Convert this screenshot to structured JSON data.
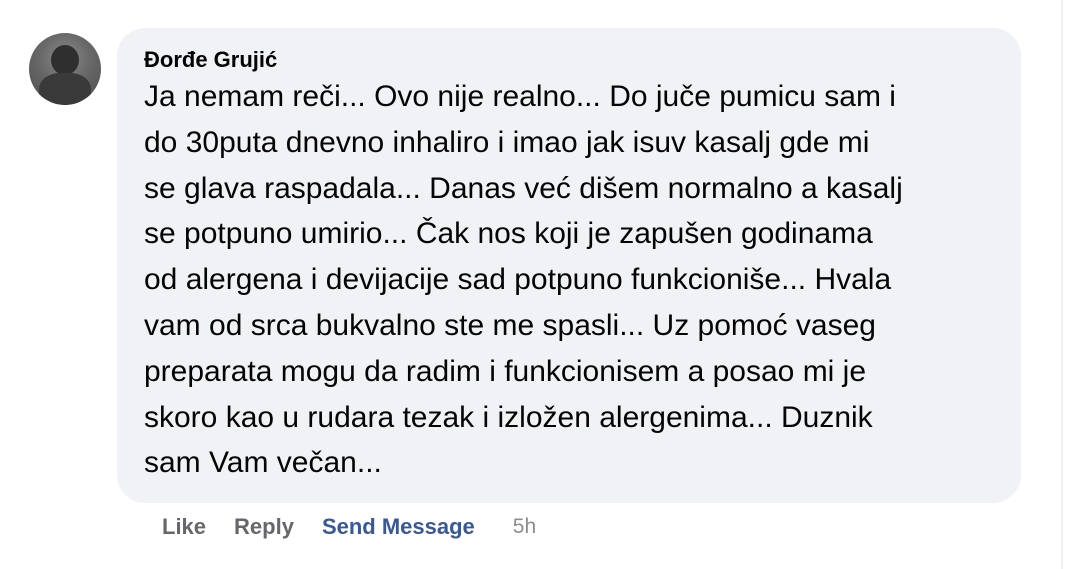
{
  "comment": {
    "author": "Đorđe Grujić",
    "text": "Ja nemam reči... Ovo nije realno... Do juče pumicu sam i\ndo 30puta dnevno inhaliro i imao jak isuv kasalj gde mi\nse glava raspadala... Danas već dišem normalno a kasalj\nse potpuno umirio... Čak nos koji je zapušen godinama\nod alergena i devijacije sad potpuno funkcioniše... Hvala\nvam od srca bukvalno ste me spasli... Uz pomoć vaseg\npreparata mogu da radim i funkcionisem a posao mi je\nskoro kao u rudara tezak i izložen alergenima... Duznik\nsam Vam večan...",
    "avatar_icon": "profile-photo"
  },
  "actions": {
    "like": "Like",
    "reply": "Reply",
    "send_message": "Send Message",
    "timestamp": "5h"
  },
  "colors": {
    "bubble_bg": "#f0f2f5",
    "text": "#050505",
    "action_gray": "#65676b",
    "accent_blue": "#385898",
    "timestamp_gray": "#8a8d91"
  }
}
